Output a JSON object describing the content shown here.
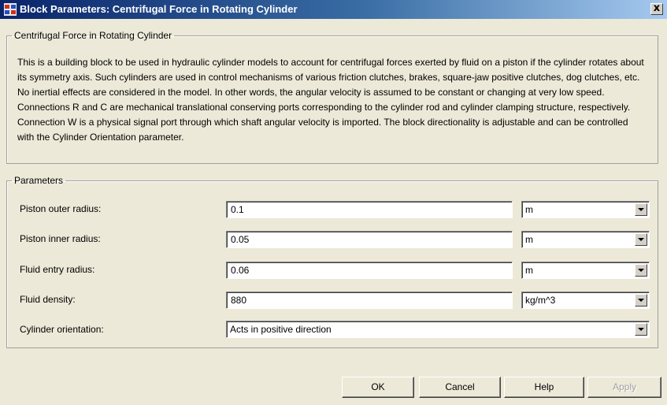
{
  "window": {
    "title": "Block Parameters: Centrifugal Force in Rotating Cylinder",
    "close_label": "x"
  },
  "description": {
    "group_title": "Centrifugal Force in Rotating Cylinder",
    "text": "This is a building block to be used in hydraulic cylinder models to account for centrifugal forces exerted by fluid on a piston if the cylinder rotates about its symmetry axis. Such cylinders are used in control mechanisms of various friction clutches, brakes, square-jaw positive clutches, dog clutches, etc. No inertial effects are considered in the model. In other words, the angular velocity is assumed to be constant or changing at very low speed. Connections R and C are mechanical translational conserving ports corresponding to the cylinder rod and cylinder clamping structure, respectively. Connection W is a physical signal port through which shaft angular velocity is imported. The block directionality is adjustable and can be controlled with the Cylinder Orientation parameter."
  },
  "parameters": {
    "group_title": "Parameters",
    "rows": [
      {
        "label": "Piston outer radius:",
        "value": "0.1",
        "unit": "m"
      },
      {
        "label": "Piston inner radius:",
        "value": "0.05",
        "unit": "m"
      },
      {
        "label": "Fluid entry radius:",
        "value": "0.06",
        "unit": "m"
      },
      {
        "label": "Fluid density:",
        "value": "880",
        "unit": "kg/m^3"
      }
    ],
    "orientation": {
      "label": "Cylinder orientation:",
      "value": "Acts in positive direction"
    }
  },
  "buttons": {
    "ok": "OK",
    "cancel": "Cancel",
    "help": "Help",
    "apply": "Apply"
  },
  "icons": {
    "app": "simulink-block-icon",
    "close": "close-icon",
    "dropdown": "chevron-down-icon"
  }
}
